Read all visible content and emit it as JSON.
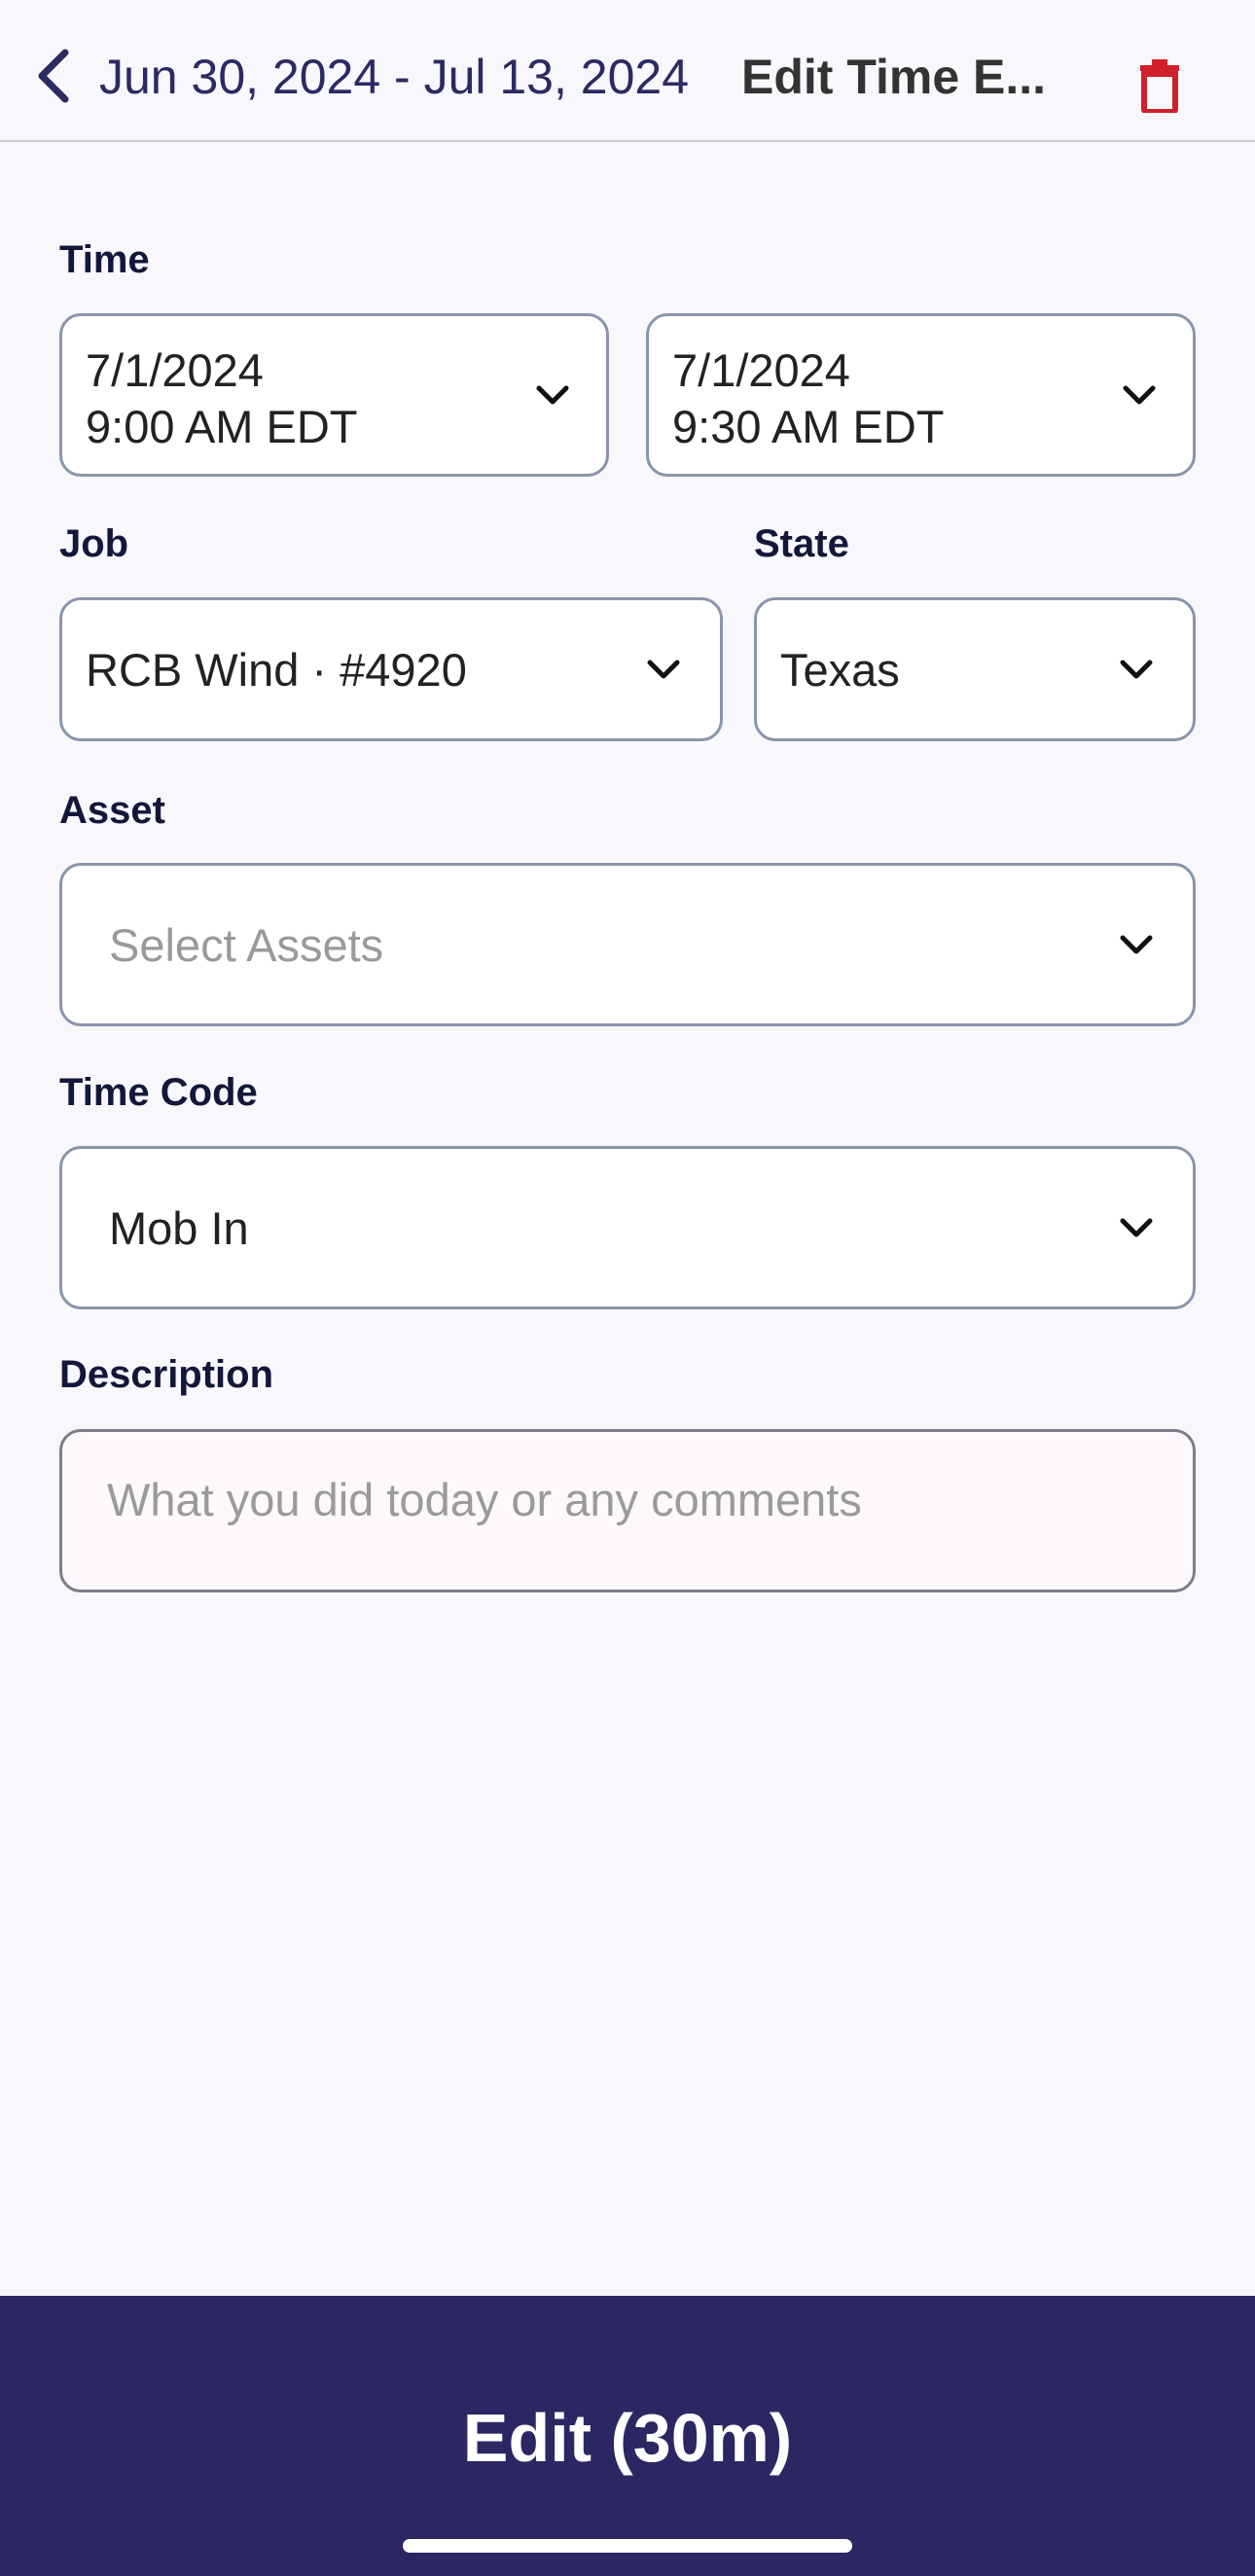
{
  "header": {
    "back_label": "Jun 30, 2024 - Jul 13, 2024",
    "title": "Edit Time E...",
    "back_icon": "chevron-left-icon",
    "delete_icon": "trash-icon",
    "delete_color": "#d0202a"
  },
  "form": {
    "time_label": "Time",
    "start_date": "7/1/2024",
    "start_time": "9:00 AM EDT",
    "end_date": "7/1/2024",
    "end_time": "9:30 AM EDT",
    "job_label": "Job",
    "job_value": "RCB Wind · #4920",
    "state_label": "State",
    "state_value": "Texas",
    "asset_label": "Asset",
    "asset_placeholder": "Select Assets",
    "time_code_label": "Time Code",
    "time_code_value": "Mob In",
    "description_label": "Description",
    "description_placeholder": "What you did today or any comments"
  },
  "footer": {
    "submit_label": "Edit (30m)",
    "bar_color": "#2b2763"
  }
}
